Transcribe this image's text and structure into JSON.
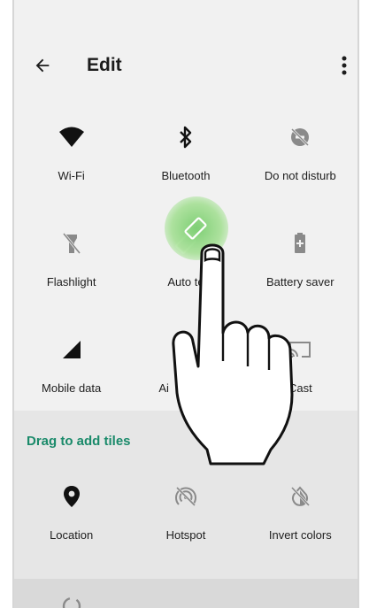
{
  "header": {
    "title": "Edit"
  },
  "current_tiles": [
    {
      "label": "Wi-Fi",
      "icon": "wifi-icon"
    },
    {
      "label": "Bluetooth",
      "icon": "bluetooth-icon"
    },
    {
      "label": "Do not disturb",
      "icon": "do-not-disturb-icon"
    },
    {
      "label": "Flashlight",
      "icon": "flashlight-icon"
    },
    {
      "label": "Auto   te",
      "icon": "auto-rotate-icon"
    },
    {
      "label": "Battery saver",
      "icon": "battery-saver-icon"
    },
    {
      "label": "Mobile data",
      "icon": "mobile-data-icon"
    },
    {
      "label": "Ai",
      "icon": "airplane-mode-icon"
    },
    {
      "label": "Cast",
      "icon": "cast-icon"
    }
  ],
  "drag_section": {
    "label": "Drag to add tiles"
  },
  "available_tiles": [
    {
      "label": "Location",
      "icon": "location-icon"
    },
    {
      "label": "Hotspot",
      "icon": "hotspot-icon"
    },
    {
      "label": "Invert colors",
      "icon": "invert-colors-icon"
    }
  ],
  "partial_tiles": [
    {
      "icon": "data-saver-icon"
    },
    {
      "icon": "night-light-icon"
    }
  ],
  "colors": {
    "accent": "#1a8a6a",
    "highlight": "#7fcf6f",
    "icon_dark": "#111111",
    "icon_muted": "#8a8a8a"
  },
  "overlay": {
    "gesture": "hand-pointer-icon"
  }
}
